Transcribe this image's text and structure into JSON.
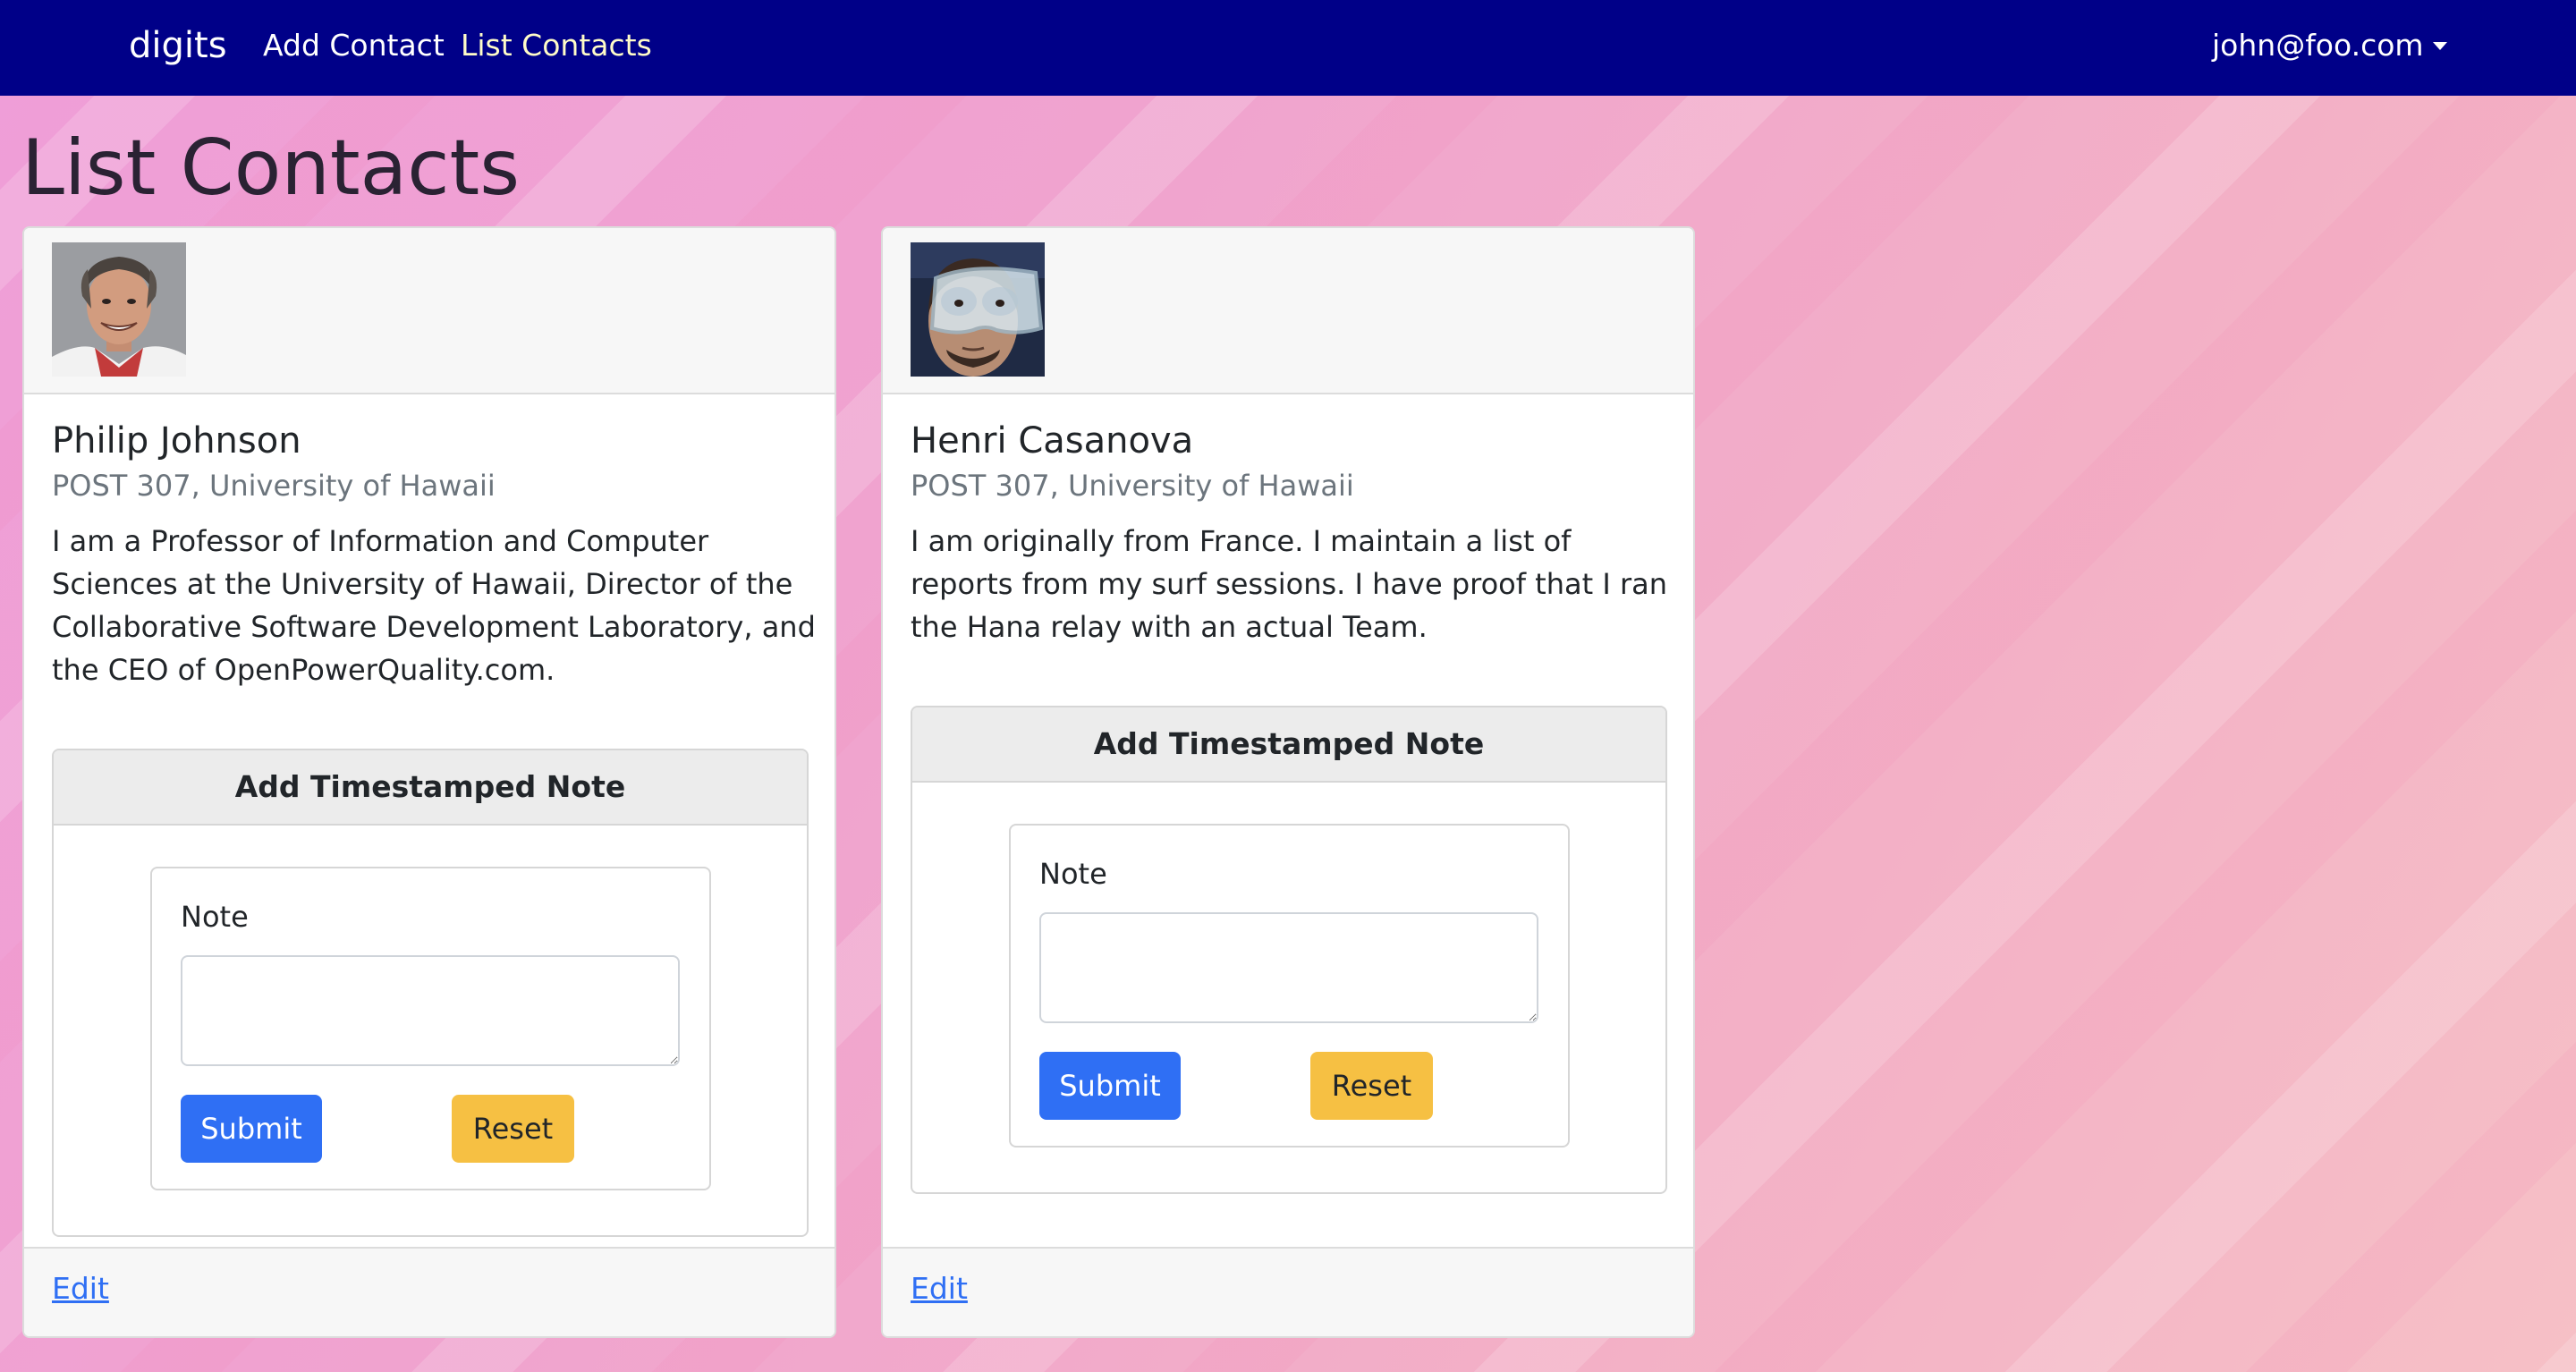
{
  "navbar": {
    "brand": "digits",
    "links": [
      "Add Contact",
      "List Contacts"
    ],
    "user": "john@foo.com"
  },
  "page": {
    "title": "List Contacts"
  },
  "colors": {
    "navbar": "#000088",
    "active_link": "#fffcc8",
    "submit": "#2f6ff4",
    "reset": "#f6c043",
    "link": "#2f6ff4"
  },
  "contacts": [
    {
      "name": "Philip Johnson",
      "address": "POST 307, University of Hawaii",
      "description": "I am a Professor of Information and Computer Sciences at the University of Hawaii, Director of the Collaborative Software Development Laboratory, and the CEO of OpenPowerQuality.com.",
      "note_card_title": "Add Timestamped Note",
      "note_label": "Note",
      "submit_label": "Submit",
      "reset_label": "Reset",
      "edit_label": "Edit"
    },
    {
      "name": "Henri Casanova",
      "address": "POST 307, University of Hawaii",
      "description": "I am originally from France. I maintain a list of reports from my surf sessions. I have proof that I ran the Hana relay with an actual Team.",
      "note_card_title": "Add Timestamped Note",
      "note_label": "Note",
      "submit_label": "Submit",
      "reset_label": "Reset",
      "edit_label": "Edit"
    }
  ]
}
